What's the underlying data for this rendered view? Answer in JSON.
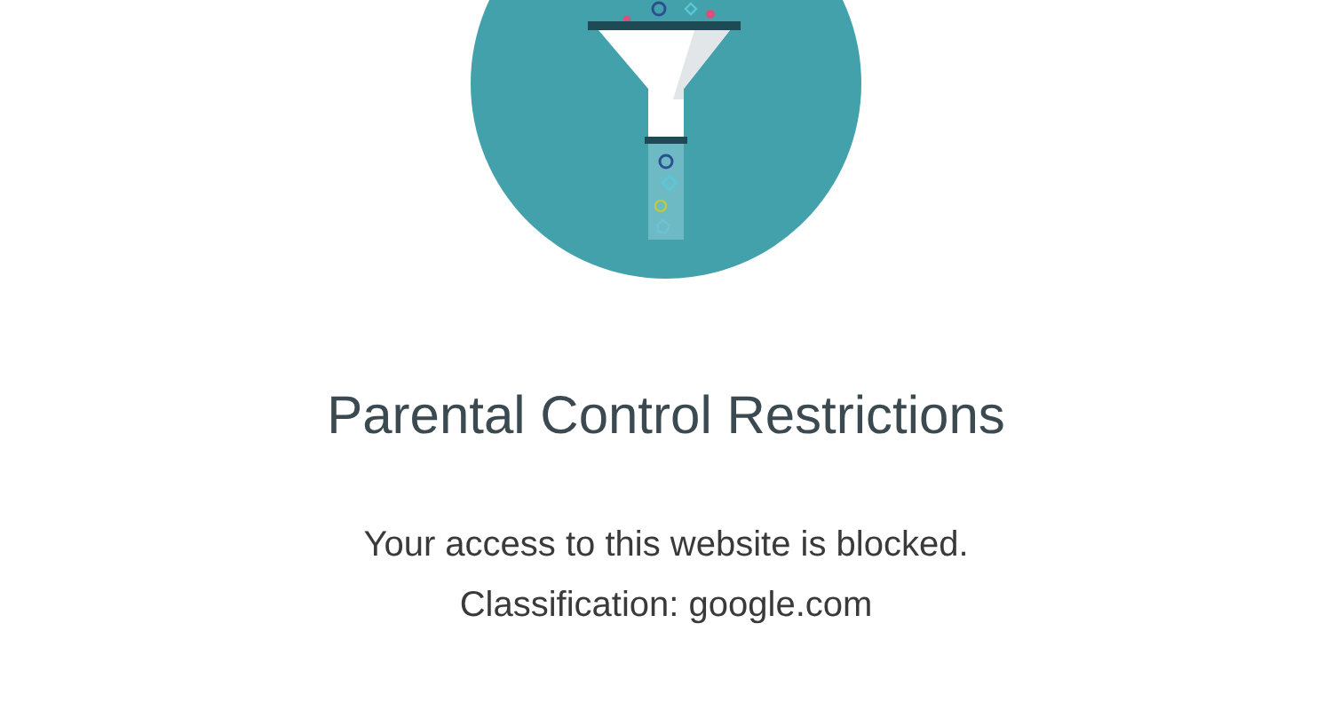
{
  "title": "Parental Control Restrictions",
  "message_lines": [
    "Your access to this website is blocked.",
    "Classification: google.com"
  ]
}
